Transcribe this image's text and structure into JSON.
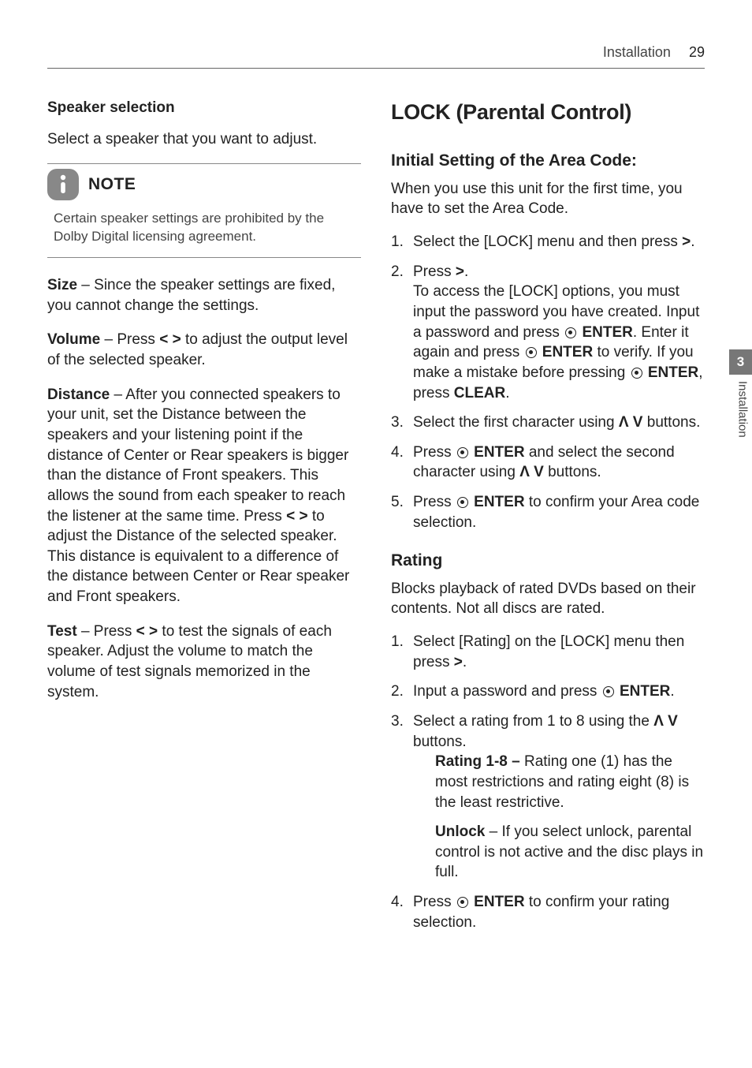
{
  "header": {
    "section": "Installation",
    "page": "29"
  },
  "sidetab": {
    "num": "3",
    "label": "Installation"
  },
  "left": {
    "h_speakersel": "Speaker selection",
    "p_select": "Select a speaker that you want to adjust.",
    "note_title": "NOTE",
    "note_body": "Certain speaker settings are prohibited by the Dolby Digital licensing agreement.",
    "size_b": "Size",
    "size_t": " – Since the speaker settings are fixed, you cannot change the settings.",
    "vol_b": "Volume",
    "vol_t1": " – Press ",
    "vol_arr": "< >",
    "vol_t2": " to adjust the output level of the selected speaker.",
    "dist_b": "Distance",
    "dist_t1": " – After you connected speakers to your unit, set the Distance between the speakers and your listening point if the distance of Center or Rear speakers is bigger than the distance of Front speakers. This allows the sound from each speaker to reach the listener at the same time. Press ",
    "dist_arr": "< >",
    "dist_t2": " to adjust the Distance of the selected speaker. This distance is equivalent to a difference of the distance between Center or Rear speaker and Front speakers.",
    "test_b": "Test",
    "test_t1": " – Press ",
    "test_arr": "< >",
    "test_t2": " to test the signals of each speaker. Adjust the volume to match the volume of test signals memorized in the system."
  },
  "right": {
    "h_lock": "LOCK (Parental Control)",
    "h_init": "Initial Setting of the Area Code:",
    "p_init": "When you use this unit for the first time, you have to set the Area Code.",
    "s1a": "Select the [LOCK] menu and then press ",
    "s1b": ">",
    "s1c": ".",
    "s2a": "Press ",
    "s2b": ">",
    "s2c": ".",
    "s2d": "To access the [LOCK] options, you must input the password you have created. Input a password and press ",
    "s2e": "ENTER",
    "s2f": ". Enter it again and press ",
    "s2g": "ENTER",
    "s2h": " to verify. If you make a mistake before pressing ",
    "s2i": "ENTER",
    "s2j": ", press ",
    "s2k": "CLEAR",
    "s2l": ".",
    "s3a": "Select the first character using ",
    "s3b": "Λ V",
    "s3c": " buttons.",
    "s4a": "Press ",
    "s4b": "ENTER",
    "s4c": " and select the second character using ",
    "s4d": "Λ V",
    "s4e": " buttons.",
    "s5a": "Press ",
    "s5b": "ENTER",
    "s5c": " to confirm your Area code selection.",
    "h_rating": "Rating",
    "p_rating": "Blocks playback of rated DVDs based on their contents. Not all discs are rated.",
    "r1a": "Select [Rating] on the [LOCK] menu then press ",
    "r1b": ">",
    "r1c": ".",
    "r2a": "Input a password and press ",
    "r2b": "ENTER",
    "r2c": ".",
    "r3a": "Select a rating from 1 to 8 using the ",
    "r3b": "Λ V",
    "r3c": " buttons.",
    "r3d_b": "Rating 1-8 – ",
    "r3d_t": "Rating one (1) has the most restrictions and rating eight (8) is the least restrictive.",
    "r3e_b": "Unlock",
    "r3e_t": " – If you select unlock, parental control is not active and the disc plays in full.",
    "r4a": "Press ",
    "r4b": "ENTER",
    "r4c": " to confirm your rating selection."
  }
}
